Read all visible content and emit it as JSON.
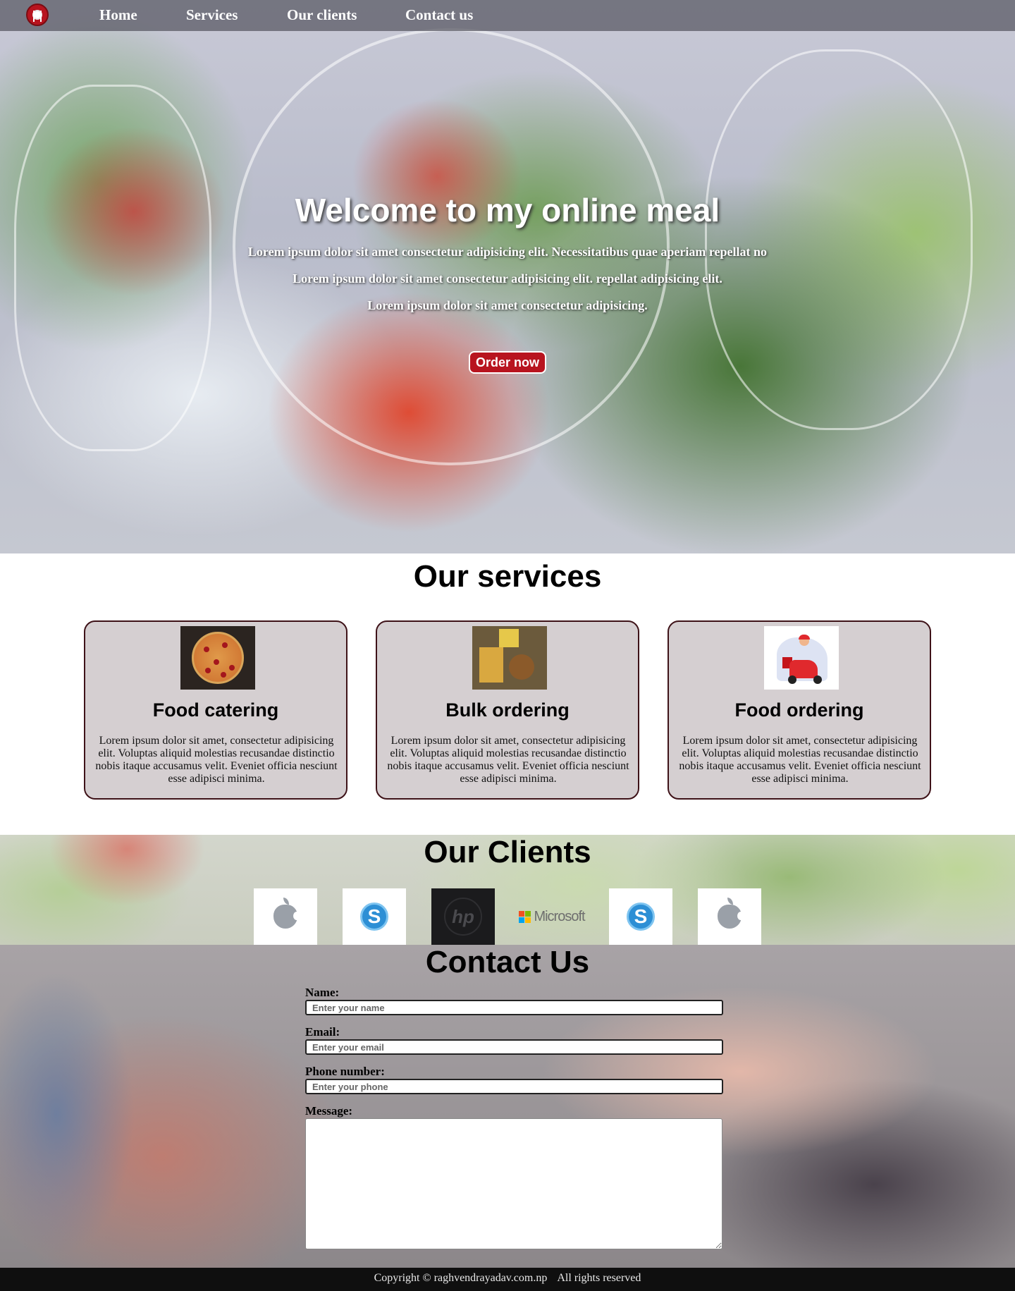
{
  "nav": {
    "logo_icon": "restaurant-plate-icon",
    "items": [
      {
        "label": "Home"
      },
      {
        "label": "Services"
      },
      {
        "label": "Our clients"
      },
      {
        "label": "Contact us"
      }
    ]
  },
  "hero": {
    "title": "Welcome to my online meal",
    "lines": [
      "Lorem ipsum dolor sit amet consectetur adipisicing elit. Necessitatibus quae aperiam repellat no",
      "Lorem ipsum dolor sit amet consectetur adipisicing elit. repellat adipisicing elit.",
      "Lorem ipsum dolor sit amet consectetur adipisicing."
    ],
    "button": "Order now"
  },
  "services": {
    "title": "Our services",
    "cards": [
      {
        "title": "Food catering",
        "image": "pizza-image",
        "text": "Lorem ipsum dolor sit amet, consectetur adipisicing elit. Voluptas aliquid molestias recusandae distinctio nobis itaque accusamus velit. Eveniet officia nesciunt esse adipisci minima."
      },
      {
        "title": "Bulk ordering",
        "image": "burger-platter-image",
        "text": "Lorem ipsum dolor sit amet, consectetur adipisicing elit. Voluptas aliquid molestias recusandae distinctio nobis itaque accusamus velit. Eveniet officia nesciunt esse adipisci minima."
      },
      {
        "title": "Food ordering",
        "image": "delivery-scooter-image",
        "text": "Lorem ipsum dolor sit amet, consectetur adipisicing elit. Voluptas aliquid molestias recusandae distinctio nobis itaque accusamus velit. Eveniet officia nesciunt esse adipisci minima."
      }
    ]
  },
  "clients": {
    "title": "Our Clients",
    "logos": [
      "apple-logo",
      "skype-logo",
      "hp-logo",
      "microsoft-logo",
      "skype-logo",
      "apple-logo"
    ],
    "microsoft_text": "Microsoft",
    "skype_glyph": "S",
    "hp_text": "hp"
  },
  "contact": {
    "title": "Contact Us",
    "name_label": "Name:",
    "name_placeholder": "Enter your name",
    "email_label": "Email:",
    "email_placeholder": "Enter your email",
    "phone_label": "Phone number:",
    "phone_placeholder": "Enter your phone",
    "message_label": "Message:"
  },
  "footer": {
    "copyright": "Copyright © raghvendrayadav.com.np",
    "rights": "All rights reserved"
  },
  "colors": {
    "brand_red": "#b8141f",
    "card_bg": "#d5cfd1",
    "card_border": "#3e1218",
    "nav_bg": "#5a5a64",
    "footer_bg": "#0f0f0f"
  }
}
